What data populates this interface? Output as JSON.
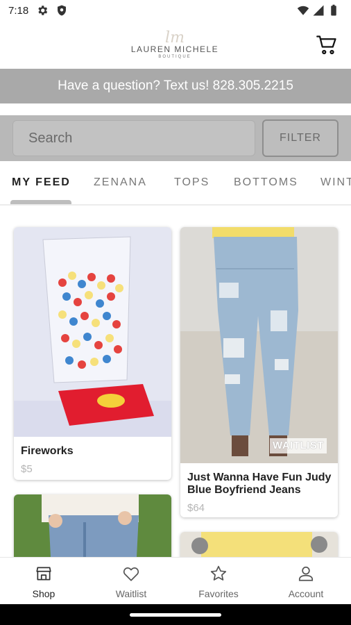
{
  "status_bar": {
    "time": "7:18",
    "icons": [
      "gear-icon",
      "shield-icon",
      "wifi-icon",
      "signal-icon",
      "battery-icon"
    ]
  },
  "header": {
    "logo_script": "lm",
    "logo_name": "LAUREN MICHELE",
    "logo_sub": "BOUTIQUE",
    "cart_icon": "cart-icon"
  },
  "announcement": {
    "text": "Have a question? Text us! 828.305.2215"
  },
  "search": {
    "placeholder": "Search",
    "filter_label": "FILTER"
  },
  "tabs": {
    "items": [
      {
        "label": "MY FEED",
        "active": true
      },
      {
        "label": "ZENANA",
        "active": false
      },
      {
        "label": "TOPS",
        "active": false
      },
      {
        "label": "BOTTOMS",
        "active": false
      },
      {
        "label": "WINT",
        "active": false
      }
    ]
  },
  "products": [
    {
      "title": "Fireworks",
      "price": "$5"
    },
    {
      "title": "Just Wanna Have Fun Judy Blue Boyfriend Jeans",
      "price": "$64",
      "badge": "WAITLIST"
    }
  ],
  "bottom_nav": {
    "items": [
      {
        "label": "Shop",
        "icon": "store-icon",
        "active": true
      },
      {
        "label": "Waitlist",
        "icon": "heart-icon",
        "active": false
      },
      {
        "label": "Favorites",
        "icon": "star-icon",
        "active": false
      },
      {
        "label": "Account",
        "icon": "person-icon",
        "active": false
      }
    ]
  },
  "colors": {
    "announcement_bg": "#a9a9a9",
    "search_area_bg": "#b8b8b8",
    "tab_indicator": "#bdbdbd",
    "price_text": "#b5b5b5"
  }
}
